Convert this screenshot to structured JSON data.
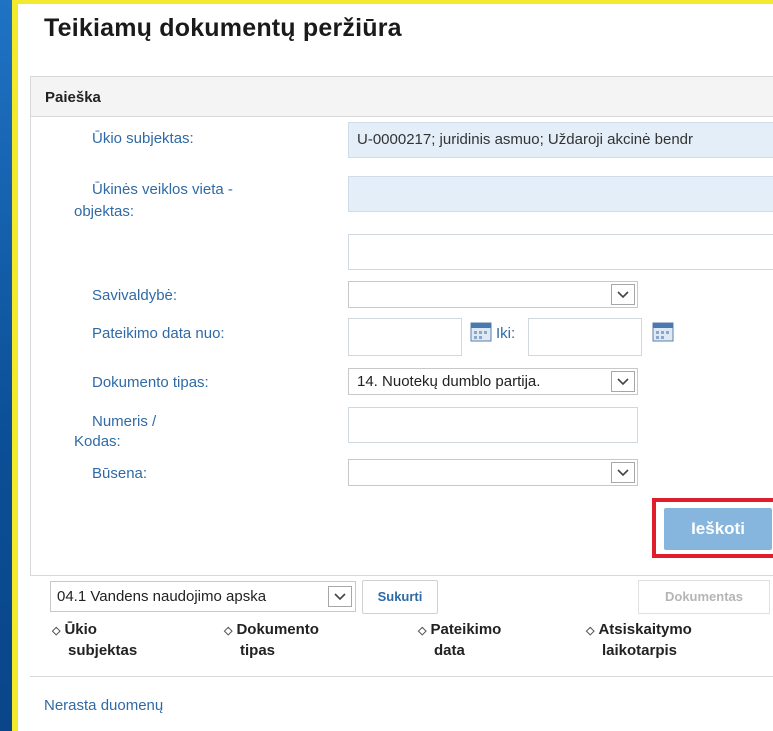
{
  "page_title": "Teikiamų dokumentų peržiūra",
  "search_panel": {
    "title": "Paieška",
    "subject_label": "Ūkio subjektas:",
    "subject_value": "U-0000217; juridinis asmuo; Uždaroji akcinė bendr",
    "site_label_1": "Ūkinės veiklos vieta -",
    "site_label_2": "objektas:",
    "site_value": "",
    "extra_value": "",
    "municipality_label": "Savivaldybė:",
    "municipality_value": "",
    "date_from_label": "Pateikimo data nuo:",
    "date_from_value": "",
    "date_to_label": "Iki:",
    "date_to_value": "",
    "doc_type_label": "Dokumento tipas:",
    "doc_type_value": "14. Nuotekų dumblo partija.",
    "number_label_1": "Numeris /",
    "number_label_2": "Kodas:",
    "number_value": "",
    "status_label": "Būsena:",
    "status_value": "",
    "search_button": "Ieškoti"
  },
  "toolbar": {
    "template_select": "04.1 Vandens naudojimo apska",
    "create_button": "Sukurti",
    "document_button": "Dokumentas"
  },
  "table": {
    "columns": [
      {
        "line1": "Ūkio",
        "line2": "subjektas"
      },
      {
        "line1": "Dokumento",
        "line2": "tipas"
      },
      {
        "line1": "Pateikimo",
        "line2": "data"
      },
      {
        "line1": "Atsiskaitymo",
        "line2": "laikotarpis"
      }
    ],
    "empty_text": "Nerasta duomenų"
  },
  "colors": {
    "accent": "#2f6aa6",
    "highlight_border": "#e11d2b",
    "frame_border": "#f2ea2a"
  }
}
